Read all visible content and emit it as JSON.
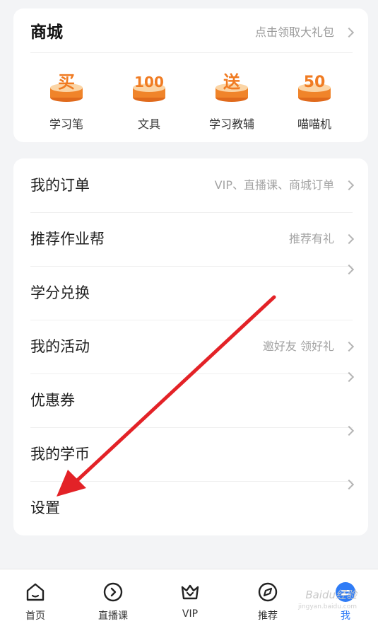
{
  "mall": {
    "title": "商城",
    "promo": "点击领取大礼包",
    "items": [
      {
        "label": "学习笔",
        "badge_text": "买",
        "icon": "buy-badge-icon"
      },
      {
        "label": "文具",
        "badge_text": "100",
        "icon": "100-badge-icon"
      },
      {
        "label": "学习教辅",
        "badge_text": "送",
        "icon": "gift-badge-icon"
      },
      {
        "label": "喵喵机",
        "badge_text": "50",
        "icon": "50-badge-icon"
      }
    ]
  },
  "menu": {
    "items": [
      {
        "label": "我的订单",
        "hint": "VIP、直播课、商城订单"
      },
      {
        "label": "推荐作业帮",
        "hint": "推荐有礼"
      },
      {
        "label": "学分兑换",
        "hint": ""
      },
      {
        "label": "我的活动",
        "hint": "邀好友 领好礼"
      },
      {
        "label": "优惠券",
        "hint": ""
      },
      {
        "label": "我的学币",
        "hint": ""
      },
      {
        "label": "设置",
        "hint": ""
      }
    ]
  },
  "tabbar": {
    "tabs": [
      {
        "label": "首页",
        "icon": "home-icon"
      },
      {
        "label": "直播课",
        "icon": "live-play-icon"
      },
      {
        "label": "VIP",
        "icon": "vip-crown-icon"
      },
      {
        "label": "推荐",
        "icon": "compass-icon"
      },
      {
        "label": "我",
        "icon": "profile-icon",
        "active": true
      }
    ]
  },
  "watermark": {
    "text": "Baidu经验",
    "sub": "jingyan.baidu.com"
  },
  "colors": {
    "accent": "#2f7cf6",
    "badge_orange": "#f08a2c",
    "arrow_red": "#e32227"
  }
}
